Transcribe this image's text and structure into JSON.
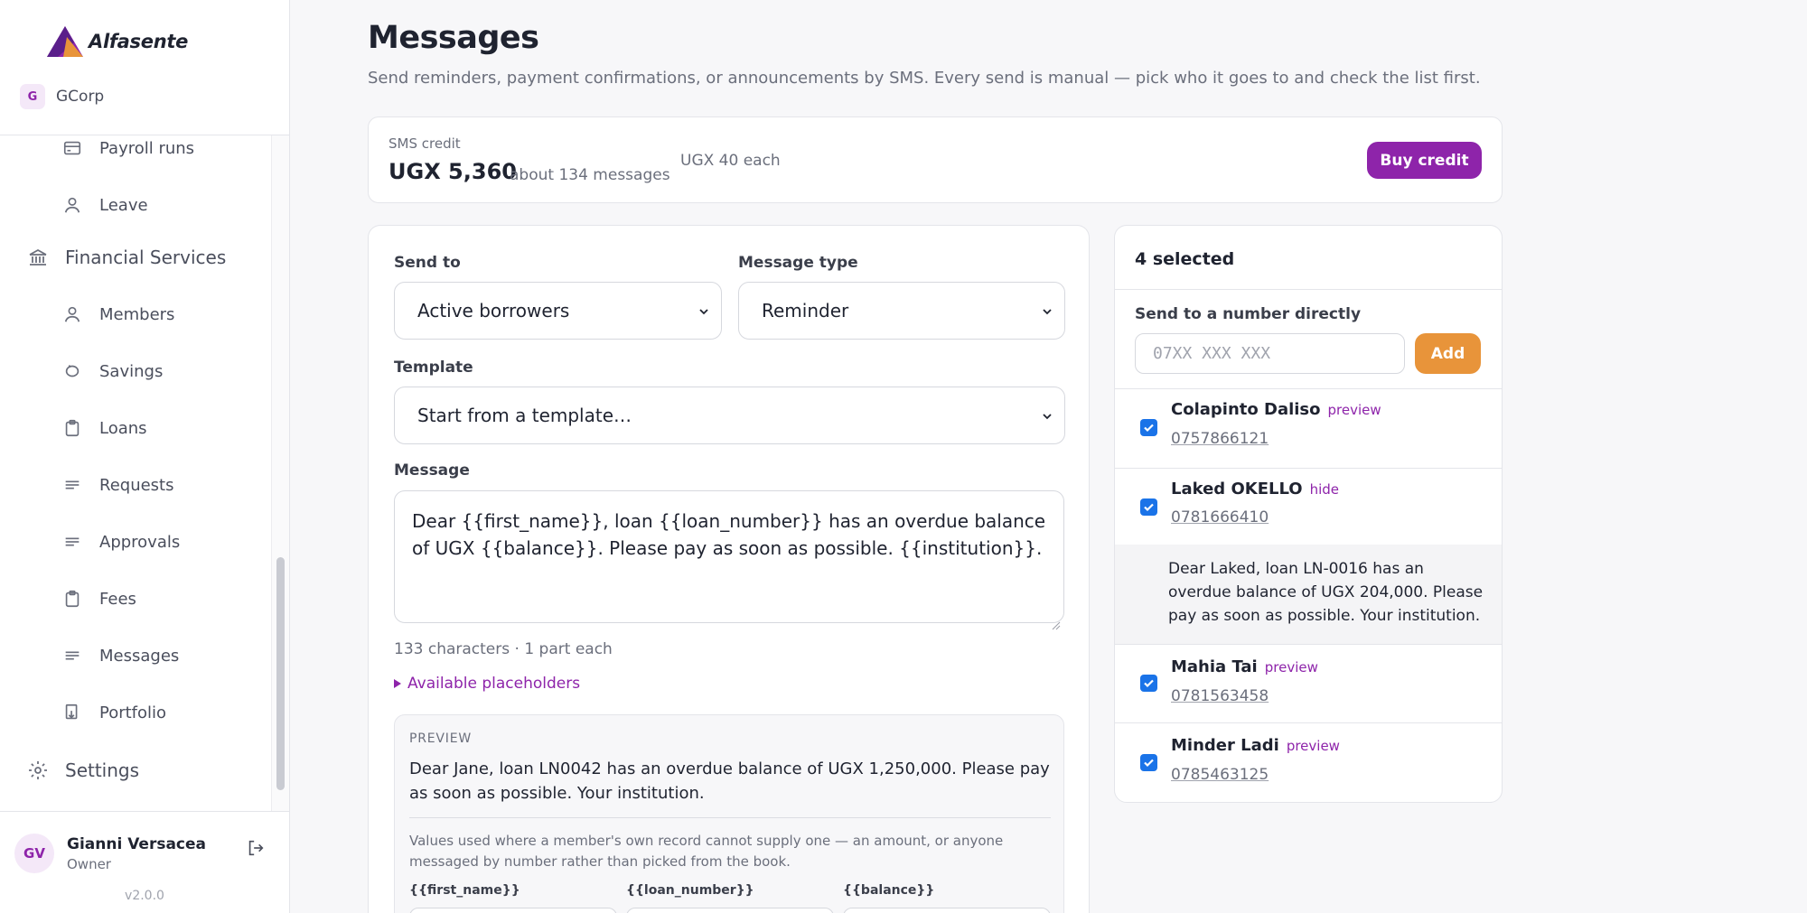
{
  "brand": {
    "name": "Alfasente"
  },
  "org": {
    "initial": "G",
    "name": "GCorp"
  },
  "nav": {
    "payroll_runs": "Payroll runs",
    "leave": "Leave",
    "financial_services": "Financial Services",
    "members": "Members",
    "savings": "Savings",
    "loans": "Loans",
    "requests": "Requests",
    "approvals": "Approvals",
    "fees": "Fees",
    "messages": "Messages",
    "portfolio": "Portfolio",
    "settings": "Settings"
  },
  "user": {
    "initials": "GV",
    "name": "Gianni Versacea",
    "role": "Owner"
  },
  "version": "v2.0.0",
  "page": {
    "title": "Messages",
    "subtitle": "Send reminders, payment confirmations, or announcements by SMS. Every send is manual — pick who it goes to and check the list first."
  },
  "credit": {
    "label": "SMS credit",
    "amount": "UGX 5,360",
    "about": "about 134 messages",
    "each": "UGX 40 each",
    "buy_label": "Buy credit"
  },
  "compose": {
    "send_to_label": "Send to",
    "send_to_value": "Active borrowers",
    "type_label": "Message type",
    "type_value": "Reminder",
    "template_label": "Template",
    "template_value": "Start from a template…",
    "message_label": "Message",
    "message_value": "Dear {{first_name}}, loan {{loan_number}} has an overdue balance of UGX {{balance}}. Please pay as soon as possible. {{institution}}.",
    "char_count": "133 characters · 1 part each",
    "placeholders_link": "Available placeholders",
    "preview_label": "PREVIEW",
    "preview_text": "Dear Jane, loan LN0042 has an overdue balance of UGX 1,250,000. Please pay as soon as possible. Your institution.",
    "preview_note": "Values used where a member's own record cannot supply one — an amount, or anyone messaged by number rather than picked from the book.",
    "ph_first_name": "{{first_name}}",
    "ph_loan_number": "{{loan_number}}",
    "ph_balance": "{{balance}}"
  },
  "recipients": {
    "selected": "4 selected",
    "direct_label": "Send to a number directly",
    "direct_placeholder": "07XX XXX XXX",
    "add_label": "Add",
    "items": [
      {
        "name": "Colapinto Daliso",
        "link": "preview",
        "phone": "0757866121",
        "checked": true
      },
      {
        "name": "Laked OKELLO",
        "link": "hide",
        "phone": "0781666410",
        "checked": true
      },
      {
        "name": "Mahia Tai",
        "link": "preview",
        "phone": "0781563458",
        "checked": true
      },
      {
        "name": "Minder Ladi",
        "link": "preview",
        "phone": "0785463125",
        "checked": true
      }
    ],
    "expanded_text": "Dear Laked, loan LN-0016 has an overdue balance of UGX 204,000. Please pay as soon as possible. Your institution."
  },
  "colors": {
    "accent": "#8e24aa",
    "add_button": "#e8943a",
    "checkbox": "#1a73e8"
  },
  "icons": [
    "logo-mark",
    "card-icon",
    "person-icon",
    "bank-icon",
    "piggy-icon",
    "clipboard-icon",
    "lines-icon",
    "portfolio-icon",
    "gear-icon",
    "logout-icon",
    "chevron-down-icon",
    "check-icon"
  ]
}
